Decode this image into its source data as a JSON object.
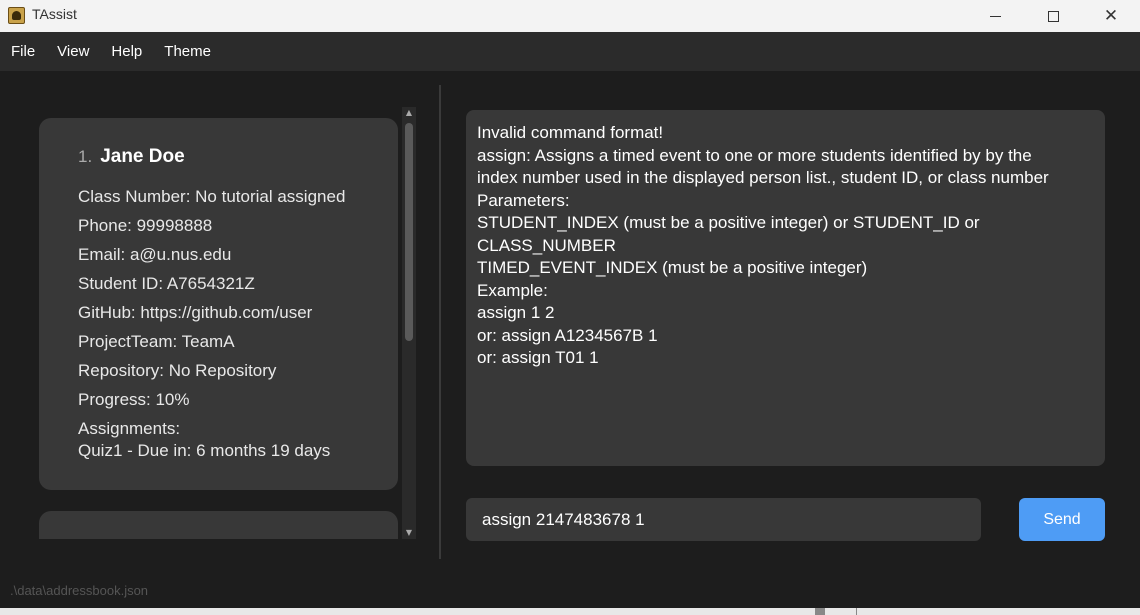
{
  "window": {
    "title": "TAssist",
    "app_icon": "app-icon"
  },
  "menu": {
    "items": [
      "File",
      "View",
      "Help",
      "Theme"
    ]
  },
  "person_list": {
    "cards": [
      {
        "index": "1.",
        "name": "Jane Doe",
        "class_number": "Class Number: No tutorial assigned",
        "phone": "Phone: 99998888",
        "email": "Email: a@u.nus.edu",
        "student_id": "Student ID: A7654321Z",
        "github": "GitHub: https://github.com/user",
        "project_team": "ProjectTeam: TeamA",
        "repository": "Repository: No Repository",
        "progress": "Progress: 10%",
        "assignments_label": "Assignments:",
        "assignments": [
          "Quiz1 - Due in: 6 months 19 days"
        ]
      }
    ]
  },
  "result": {
    "lines": [
      "Invalid command format!",
      "assign: Assigns a timed event to one or more students identified by by the",
      "index number used in the displayed person list., student ID, or class number",
      "Parameters:",
      "STUDENT_INDEX (must be a positive integer) or STUDENT_ID or",
      "CLASS_NUMBER",
      "TIMED_EVENT_INDEX (must be a positive integer)",
      "Example:",
      "assign 1 2",
      "or: assign A1234567B 1",
      "or: assign T01 1"
    ]
  },
  "command": {
    "value": "assign 2147483678 1",
    "send_label": "Send"
  },
  "status": {
    "file_path": ".\\data\\addressbook.json"
  },
  "colors": {
    "accent": "#4e9cf5",
    "card_bg": "#383838",
    "background": "#1d1d1d",
    "menubar_bg": "#2b2b2b",
    "titlebar_bg": "#f3f3f3"
  }
}
